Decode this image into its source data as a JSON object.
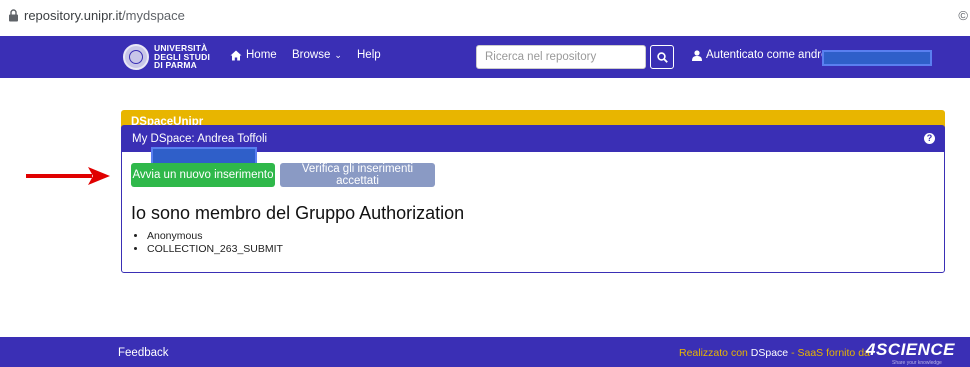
{
  "browser": {
    "url_host": "repository.unipr.it",
    "url_path": "/mydspace",
    "right_glyph": "©"
  },
  "navbar": {
    "logo_lines": [
      "UNIVERSITÀ",
      "DEGLI STUDI",
      "DI PARMA"
    ],
    "home_label": "Home",
    "browse_label": "Browse",
    "browse_caret": "⌄",
    "help_label": "Help",
    "search_placeholder": "Ricerca nel repository",
    "auth_label": "Autenticato come andrea.t"
  },
  "banner": {
    "label": "DSpaceUnipr"
  },
  "panel": {
    "title": "My DSpace: Andrea Toffoli",
    "help_glyph": "?",
    "btn_new": "Avvia un nuovo inserimento",
    "btn_verify": "Verifica gli inserimenti accettati",
    "group_title": "Io sono membro del Gruppo Authorization",
    "groups": [
      "Anonymous",
      "COLLECTION_263_SUBMIT"
    ]
  },
  "footer": {
    "feedback": "Feedback",
    "credit_prefix": "Realizzato con",
    "credit_dspace": "DSpace",
    "credit_suffix": " - SaaS fornito da",
    "science_logo": "4SCIENCE",
    "science_tag": "Share your knowledge"
  },
  "colors": {
    "brand": "#3a2fb5",
    "banner": "#e8b500",
    "btn_new": "#2fb84a",
    "btn_verify": "#8a9ac4",
    "arrow": "#e00000"
  }
}
